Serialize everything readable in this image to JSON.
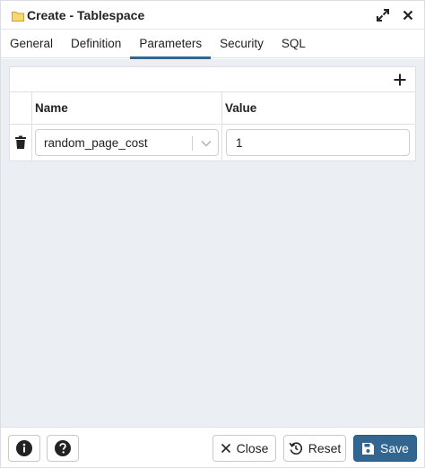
{
  "dialog": {
    "title": "Create - Tablespace"
  },
  "tabs": [
    {
      "label": "General"
    },
    {
      "label": "Definition"
    },
    {
      "label": "Parameters",
      "active": true
    },
    {
      "label": "Security"
    },
    {
      "label": "SQL"
    }
  ],
  "grid": {
    "columns": {
      "name": "Name",
      "value": "Value"
    },
    "rows": [
      {
        "name": "random_page_cost",
        "value": "1"
      }
    ]
  },
  "footer": {
    "close_label": "Close",
    "reset_label": "Reset",
    "save_label": "Save"
  },
  "colors": {
    "accent": "#326690",
    "content_bg": "#ebeef3",
    "folder": "#f2c94c"
  },
  "icons": [
    "folder-icon",
    "expand-icon",
    "close-icon",
    "add-icon",
    "trash-icon",
    "chevron-down-icon",
    "info-icon",
    "help-icon",
    "x-icon",
    "reset-icon",
    "save-icon"
  ]
}
